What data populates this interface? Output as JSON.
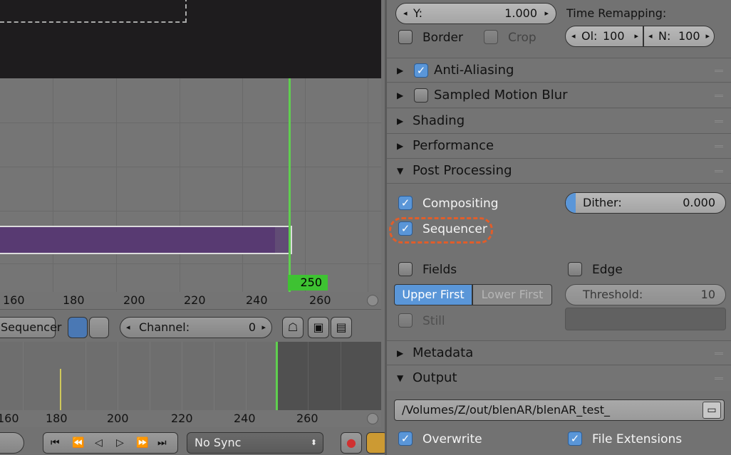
{
  "seq_editor": {
    "frame_cursor": "250",
    "ruler_labels": [
      "160",
      "180",
      "200",
      "220",
      "240",
      "260"
    ],
    "header": {
      "view_mode": "Sequencer",
      "channel_label": "Channel:",
      "channel_value": "0"
    }
  },
  "timeline": {
    "ruler_labels": [
      "160",
      "180",
      "200",
      "220",
      "240",
      "260"
    ],
    "sync_mode": "No Sync"
  },
  "render_props": {
    "y_label": "Y:",
    "y_value": "1.000",
    "time_remapping_label": "Time Remapping:",
    "old_label": "Ol:",
    "old_value": "100",
    "new_label": "N:",
    "new_value": "100",
    "border_label": "Border",
    "crop_label": "Crop",
    "panels": {
      "anti_aliasing": "Anti-Aliasing",
      "sampled_motion_blur": "Sampled Motion Blur",
      "shading": "Shading",
      "performance": "Performance",
      "post_processing": "Post Processing",
      "metadata": "Metadata",
      "output": "Output"
    },
    "compositing_label": "Compositing",
    "sequencer_label": "Sequencer",
    "dither_label": "Dither:",
    "dither_value": "0.000",
    "fields_label": "Fields",
    "edge_label": "Edge",
    "upper_first": "Upper First",
    "lower_first": "Lower First",
    "threshold_label": "Threshold:",
    "threshold_value": "10",
    "still_label": "Still",
    "output_path": "/Volumes/Z/out/blenAR/blenAR_test_",
    "overwrite_label": "Overwrite",
    "file_extensions_label": "File Extensions"
  }
}
